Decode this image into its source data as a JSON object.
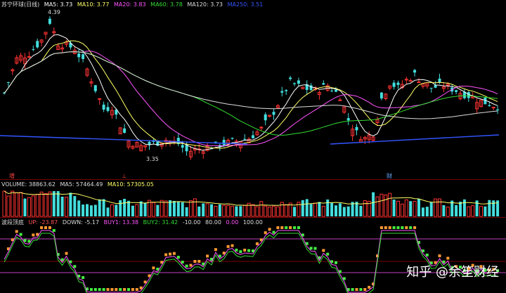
{
  "stock": {
    "title": "苏宁环球(日线)",
    "ma_labels": [
      {
        "text": "MA5: 3.73",
        "color": "#ffffff"
      },
      {
        "text": "MA10: 3.77",
        "color": "#ffff66"
      },
      {
        "text": "MA20: 3.83",
        "color": "#ff55ff"
      },
      {
        "text": "MA60: 3.78",
        "color": "#33dd33"
      },
      {
        "text": "MA120: 3.73",
        "color": "#dddddd"
      },
      {
        "text": "MA250: 3.51",
        "color": "#3355ff"
      }
    ],
    "high_label": "4.39",
    "low_label": "3.35",
    "markers": [
      {
        "text": "增",
        "color": "#ff4444"
      },
      {
        "text": "⊥",
        "color": "#ff4444"
      },
      {
        "text": "财",
        "color": "#66aaff"
      }
    ],
    "colors": {
      "up": "#ff3333",
      "down": "#44dddd",
      "ma5": "#ffffff",
      "ma10": "#ffff66",
      "ma20": "#ff55ff",
      "ma60": "#33dd33",
      "ma120": "#dddddd",
      "ma250": "#3355ff",
      "grid": "#7a0000"
    }
  },
  "volume": {
    "labels": [
      {
        "text": "VOLUME: 38863.62",
        "color": "#dddddd"
      },
      {
        "text": "MA5: 57464.49",
        "color": "#dddddd"
      },
      {
        "text": "MA10: 57305.05",
        "color": "#ffff66"
      }
    ]
  },
  "oscillator": {
    "labels": [
      {
        "text": "波段顶底",
        "color": "#dddddd"
      },
      {
        "text": "UP: -23.87",
        "color": "#ff5555"
      },
      {
        "text": "DOWN: -5.17",
        "color": "#dddddd"
      },
      {
        "text": "BUY1: 13.38",
        "color": "#ff55ff"
      },
      {
        "text": "BUY2: 31.42",
        "color": "#33dd33"
      },
      {
        "text": "-10.00",
        "color": "#dddddd"
      },
      {
        "text": "80.00",
        "color": "#dddddd"
      },
      {
        "text": "0.00",
        "color": "#ff55ff"
      },
      {
        "text": "100.00",
        "color": "#dddddd"
      }
    ]
  },
  "watermark": "知乎 @余笙财经"
}
